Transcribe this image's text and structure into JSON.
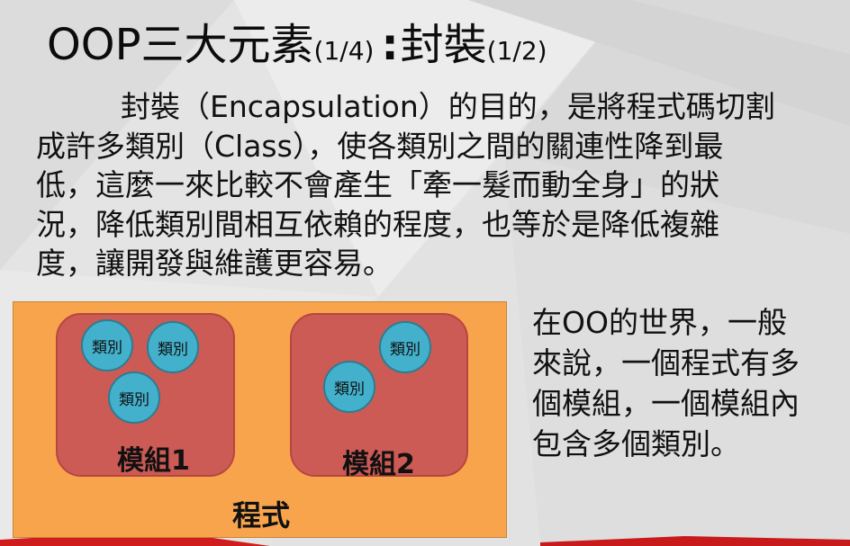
{
  "slide": {
    "title": {
      "main": "OOP三大元素",
      "part1": "(1/4)",
      "colon": ":",
      "topic": "封裝",
      "part2": "(1/2)"
    },
    "body_lines": [
      "封裝（Encapsulation）的目的，是將程式碼切割",
      "成許多類別（Class），使各類別之間的關連性降到最",
      "低，這麼一來比較不會產生「牽一髮而動全身」的狀",
      "況，降低類別間相互依賴的程度，也等於是降低複雜",
      "度，讓開發與維護更容易。"
    ],
    "side_lines": [
      "在OO的世界，一般",
      "來說，一個程式有多",
      "個模組，一個模組內",
      "包含多個類別。"
    ]
  },
  "diagram": {
    "program_label": "程式",
    "modules": [
      {
        "label": "模組1",
        "classes": [
          "類別",
          "類別",
          "類別"
        ]
      },
      {
        "label": "模組2",
        "classes": [
          "類別",
          "類別"
        ]
      }
    ]
  },
  "colors": {
    "program_fill": "#f8a44c",
    "module_fill": "#cc5a55",
    "class_fill": "#43b1cc",
    "footer_red": "#d01c1c"
  }
}
